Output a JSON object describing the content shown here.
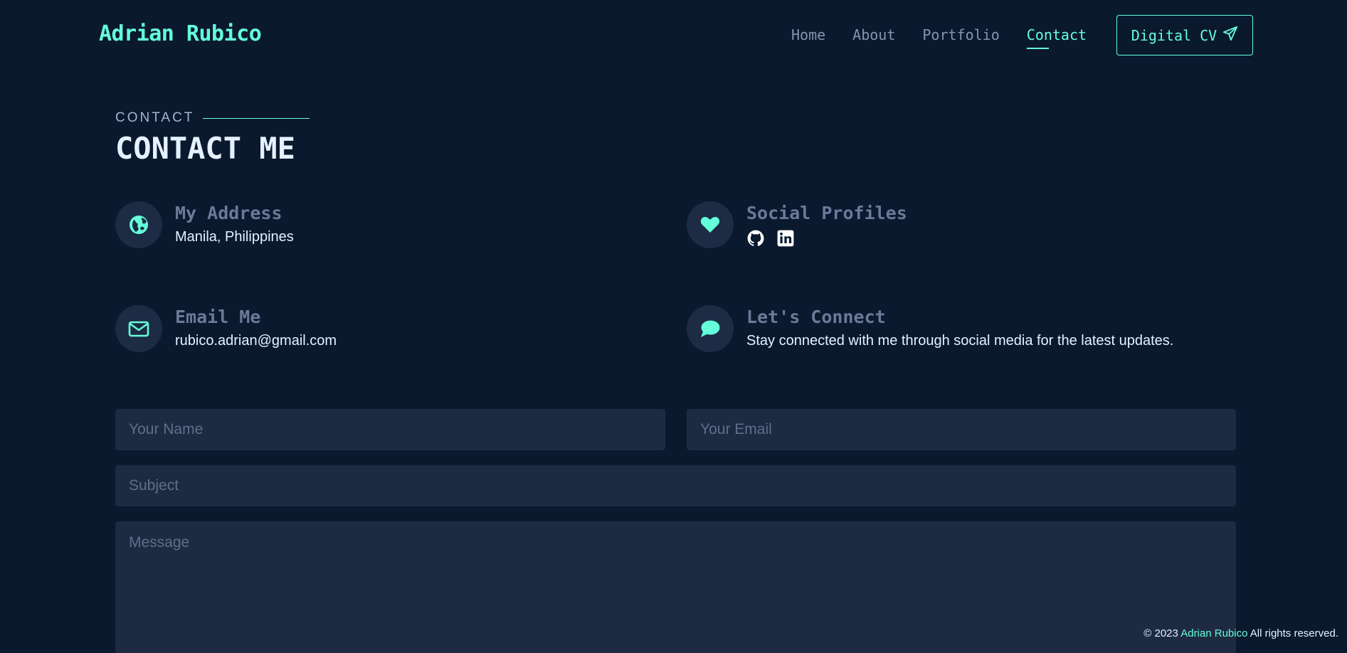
{
  "header": {
    "brand": "Adrian Rubico",
    "nav": [
      "Home",
      "About",
      "Portfolio",
      "Contact"
    ],
    "active_nav": "Contact",
    "cv_button": "Digital CV"
  },
  "section": {
    "kicker": "CONTACT",
    "title": "CONTACT ME"
  },
  "info": {
    "address": {
      "label": "My Address",
      "value": "Manila, Philippines",
      "icon": "globe-icon"
    },
    "social": {
      "label": "Social Profiles",
      "icons": [
        "github-icon",
        "linkedin-icon"
      ],
      "icon": "heart-icon"
    },
    "email": {
      "label": "Email Me",
      "value": "rubico.adrian@gmail.com",
      "icon": "envelope-icon"
    },
    "connect": {
      "label": "Let's Connect",
      "value": "Stay connected with me through social media for the latest updates.",
      "icon": "chat-icon"
    }
  },
  "form": {
    "name_placeholder": "Your Name",
    "email_placeholder": "Your Email",
    "subject_placeholder": "Subject",
    "message_placeholder": "Message"
  },
  "footer": {
    "prefix": "© 2023",
    "name": "Adrian Rubico",
    "suffix": "All rights reserved."
  },
  "colors": {
    "background": "#0b192f",
    "accent": "#64ffda",
    "field": "#1d2a42",
    "icon_circle": "#1d2b44"
  }
}
